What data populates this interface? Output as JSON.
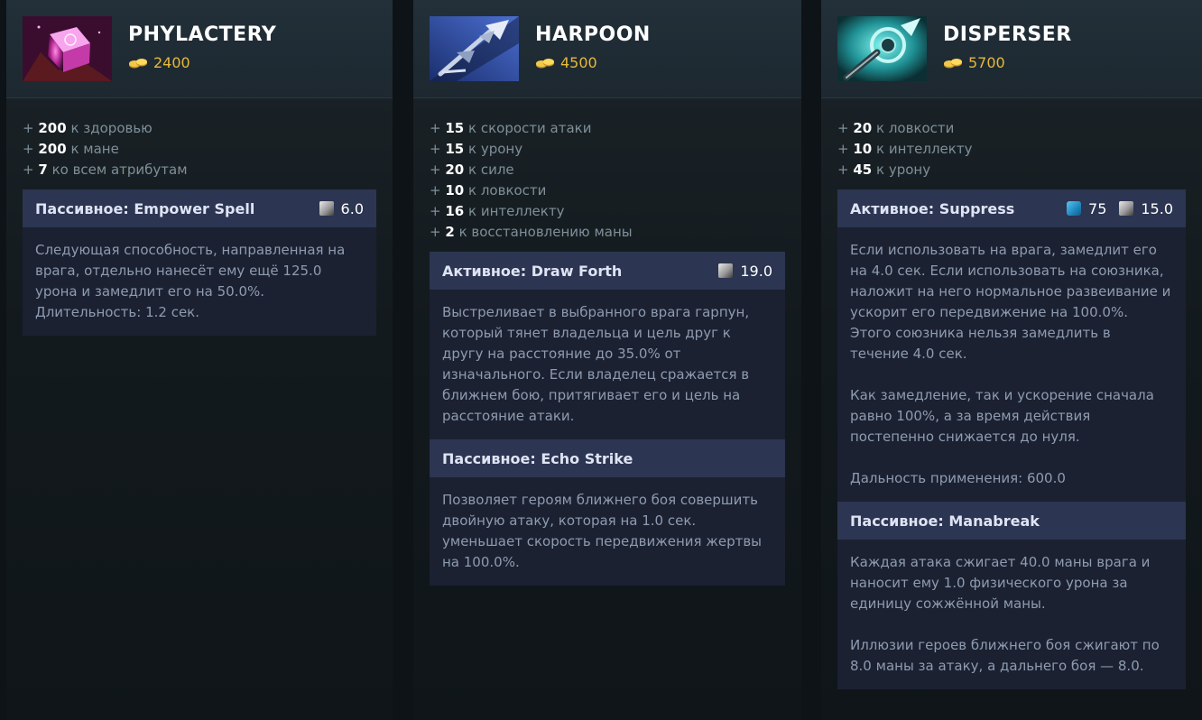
{
  "items": [
    {
      "name": "PHYLACTERY",
      "cost": "2400",
      "icon": "phylactery-item-icon",
      "stats": [
        {
          "plus": "+",
          "value": "200",
          "text": "к здоровью"
        },
        {
          "plus": "+",
          "value": "200",
          "text": "к мане"
        },
        {
          "plus": "+",
          "value": "7",
          "text": "ко всем атрибутам"
        }
      ],
      "abilities": [
        {
          "title": "Пассивное: Empower Spell",
          "cooldown": "6.0",
          "paragraphs": [
            "Следующая способность, направленная на врага, отдельно нанесёт ему ещё 125.0 урона и замедлит его на 50.0%. Длительность: 1.2 сек."
          ]
        }
      ]
    },
    {
      "name": "HARPOON",
      "cost": "4500",
      "icon": "harpoon-item-icon",
      "stats": [
        {
          "plus": "+",
          "value": "15",
          "text": "к скорости атаки"
        },
        {
          "plus": "+",
          "value": "15",
          "text": "к урону"
        },
        {
          "plus": "+",
          "value": "20",
          "text": "к силе"
        },
        {
          "plus": "+",
          "value": "10",
          "text": "к ловкости"
        },
        {
          "plus": "+",
          "value": "16",
          "text": "к интеллекту"
        },
        {
          "plus": "+",
          "value": "2",
          "text": "к восстановлению маны"
        }
      ],
      "abilities": [
        {
          "title": "Активное: Draw Forth",
          "cooldown": "19.0",
          "paragraphs": [
            "Выстреливает в выбранного врага гарпун, который тянет владельца и цель друг к другу на расстояние до 35.0% от изначального. Если владелец сражается в ближнем бою, притягивает его и цель на расстояние атаки."
          ]
        },
        {
          "title": "Пассивное: Echo Strike",
          "paragraphs": [
            "Позволяет героям ближнего боя совершить двойную атаку, которая на 1.0 сек. уменьшает скорость передвижения жертвы на 100.0%."
          ]
        }
      ]
    },
    {
      "name": "DISPERSER",
      "cost": "5700",
      "icon": "disperser-item-icon",
      "stats": [
        {
          "plus": "+",
          "value": "20",
          "text": "к ловкости"
        },
        {
          "plus": "+",
          "value": "10",
          "text": "к интеллекту"
        },
        {
          "plus": "+",
          "value": "45",
          "text": "к урону"
        }
      ],
      "abilities": [
        {
          "title": "Активное: Suppress",
          "mana": "75",
          "cooldown": "15.0",
          "paragraphs": [
            "Если использовать на врага, замедлит его на 4.0 сек. Если использовать на союзника, наложит на него нормальное развеивание и ускорит его передвижение на 100.0%. Этого союзника нельзя замедлить в течение 4.0 сек.",
            "Как замедление, так и ускорение сначала равно 100%, а за время действия постепенно снижается до нуля.",
            "Дальность применения: 600.0"
          ]
        },
        {
          "title": "Пассивное: Manabreak",
          "paragraphs": [
            "Каждая атака сжигает 40.0 маны врага и наносит ему 1.0 физического урона за единицу сожжённой маны.",
            "Иллюзии героев ближнего боя сжигают по 8.0 маны за атаку, а дальнего боя — 8.0."
          ]
        }
      ]
    }
  ]
}
